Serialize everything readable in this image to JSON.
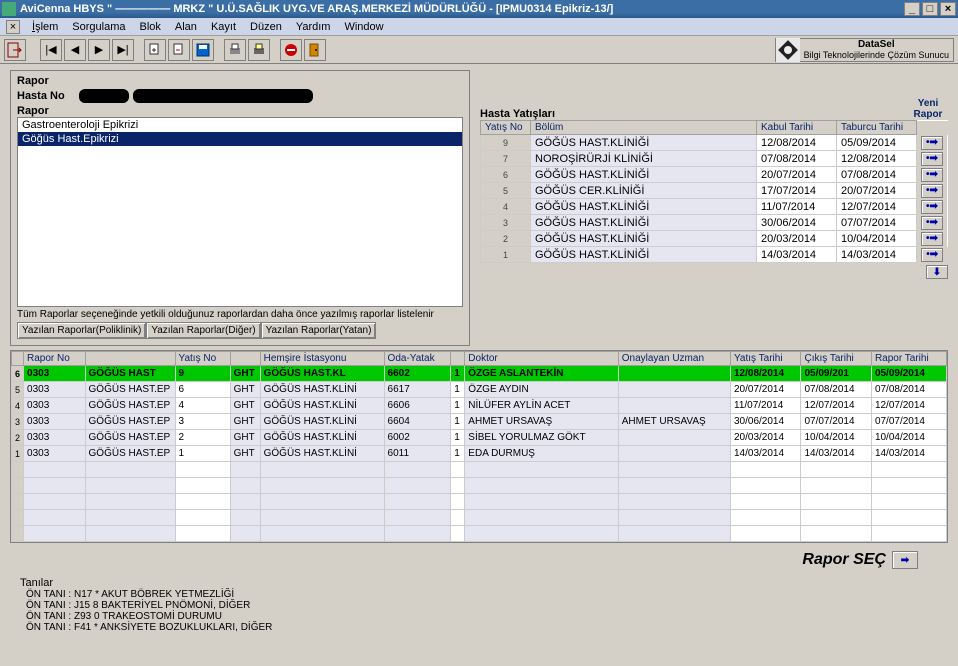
{
  "title": "AviCenna HBYS \" ————— MRKZ \" U.Ü.SAĞLIK UYG.VE ARAŞ.MERKEZİ MÜDÜRLÜĞÜ - [IPMU0314 Epikriz-13/]",
  "menu": {
    "islem": "İşlem",
    "sorgulama": "Sorgulama",
    "blok": "Blok",
    "alan": "Alan",
    "kayit": "Kayıt",
    "duzen": "Düzen",
    "yardim": "Yardım",
    "window": "Window"
  },
  "brand": {
    "name": "DataSel",
    "slogan": "Bilgi Teknolojilerinde Çözüm Sunucu"
  },
  "rapor": {
    "section": "Rapor",
    "hastaNoLabel": "Hasta No",
    "raporLabel": "Rapor",
    "options": [
      "Gastroenteroloji Epikrizi",
      "Göğüs Hast.Epikrizi"
    ],
    "selectedIndex": 1,
    "hint": "Tüm Raporlar seçeneğinde yetkili olduğunuz raporlardan daha önce yazılmış raporlar listelenir",
    "btnPoliklinik": "Yazılan Raporlar(Poliklinik)",
    "btnDiger": "Yazılan Raporlar(Diğer)",
    "btnYatan": "Yazılan Raporlar(Yatan)"
  },
  "hastaYatis": {
    "section": "Hasta Yatışları",
    "yeniRapor": "Yeni Rapor",
    "cols": {
      "yatisNo": "Yatış No",
      "bolum": "Bölüm",
      "kabul": "Kabul Tarihi",
      "taburcu": "Taburcu Tarihi"
    },
    "rows": [
      {
        "no": "9",
        "bolum": "GÖĞÜS HAST.KLİNİĞİ",
        "kabul": "12/08/2014",
        "taburcu": "05/09/2014"
      },
      {
        "no": "7",
        "bolum": "NOROŞİRÜRJİ KLİNİĞİ",
        "kabul": "07/08/2014",
        "taburcu": "12/08/2014"
      },
      {
        "no": "6",
        "bolum": "GÖĞÜS HAST.KLİNİĞİ",
        "kabul": "20/07/2014",
        "taburcu": "07/08/2014"
      },
      {
        "no": "5",
        "bolum": "GÖĞÜS CER.KLİNİĞİ",
        "kabul": "17/07/2014",
        "taburcu": "20/07/2014"
      },
      {
        "no": "4",
        "bolum": "GÖĞÜS HAST.KLİNİĞİ",
        "kabul": "11/07/2014",
        "taburcu": "12/07/2014"
      },
      {
        "no": "3",
        "bolum": "GÖĞÜS HAST.KLİNİĞİ",
        "kabul": "30/06/2014",
        "taburcu": "07/07/2014"
      },
      {
        "no": "2",
        "bolum": "GÖĞÜS HAST.KLİNİĞİ",
        "kabul": "20/03/2014",
        "taburcu": "10/04/2014"
      },
      {
        "no": "1",
        "bolum": "GÖĞÜS HAST.KLİNİĞİ",
        "kabul": "14/03/2014",
        "taburcu": "14/03/2014"
      }
    ]
  },
  "detail": {
    "cols": {
      "idx": "",
      "raporNo": "Rapor No",
      "svc": "",
      "yatisNo": "Yatış No",
      "hkod": "",
      "hemsire": "Hemşire İstasyonu",
      "oda": "Oda-Yatak",
      "y": "",
      "doktor": "Doktor",
      "onay": "Onaylayan Uzman",
      "ytarih": "Yatış Tarihi",
      "ctarih": "Çıkış Tarihi",
      "rtarih": "Rapor Tarihi"
    },
    "rows": [
      {
        "idx": "6",
        "rn": "0303",
        "svc": "GÖĞÜS HAST",
        "yn": "9",
        "hk": "GHT",
        "hs": "GÖĞÜS HAST.KL",
        "oda": "6602",
        "y": "1",
        "dr": "ÖZGE ASLANTEKİN",
        "onay": "",
        "yt": "12/08/2014",
        "ct": "05/09/201",
        "rt": "05/09/2014",
        "hl": true
      },
      {
        "idx": "5",
        "rn": "0303",
        "svc": "GÖĞÜS HAST.EP",
        "yn": "6",
        "hk": "GHT",
        "hs": "GÖĞÜS HAST.KLİNİ",
        "oda": "6617",
        "y": "1",
        "dr": "ÖZGE AYDIN",
        "onay": "",
        "yt": "20/07/2014",
        "ct": "07/08/2014",
        "rt": "07/08/2014"
      },
      {
        "idx": "4",
        "rn": "0303",
        "svc": "GÖĞÜS HAST.EP",
        "yn": "4",
        "hk": "GHT",
        "hs": "GÖĞÜS HAST.KLİNİ",
        "oda": "6606",
        "y": "1",
        "dr": "NİLÜFER AYLİN ACET",
        "onay": "",
        "yt": "11/07/2014",
        "ct": "12/07/2014",
        "rt": "12/07/2014"
      },
      {
        "idx": "3",
        "rn": "0303",
        "svc": "GÖĞÜS HAST.EP",
        "yn": "3",
        "hk": "GHT",
        "hs": "GÖĞÜS HAST.KLİNİ",
        "oda": "6604",
        "y": "1",
        "dr": "AHMET URSAVAŞ",
        "onay": "AHMET URSAVAŞ",
        "yt": "30/06/2014",
        "ct": "07/07/2014",
        "rt": "07/07/2014"
      },
      {
        "idx": "2",
        "rn": "0303",
        "svc": "GÖĞÜS HAST.EP",
        "yn": "2",
        "hk": "GHT",
        "hs": "GÖĞÜS HAST.KLİNİ",
        "oda": "6002",
        "y": "1",
        "dr": "SİBEL YORULMAZ GÖKT",
        "onay": "",
        "yt": "20/03/2014",
        "ct": "10/04/2014",
        "rt": "10/04/2014"
      },
      {
        "idx": "1",
        "rn": "0303",
        "svc": "GÖĞÜS HAST.EP",
        "yn": "1",
        "hk": "GHT",
        "hs": "GÖĞÜS HAST.KLİNİ",
        "oda": "6011",
        "y": "1",
        "dr": "EDA DURMUŞ",
        "onay": "",
        "yt": "14/03/2014",
        "ct": "14/03/2014",
        "rt": "14/03/2014"
      }
    ]
  },
  "raporSec": "Rapor SEÇ",
  "tanilar": {
    "hdr": "Tanılar",
    "rows": [
      "ÖN TANI   : N17 * AKUT BÖBREK YETMEZLİĞİ",
      "ÖN TANI   : J15 8 BAKTERİYEL PNÖMONİ, DİĞER",
      "ÖN TANI   : Z93 0 TRAKEOSTOMİ DURUMU",
      "ÖN TANI   : F41 * ANKSİYETE BOZUKLUKLARI, DİĞER"
    ]
  }
}
